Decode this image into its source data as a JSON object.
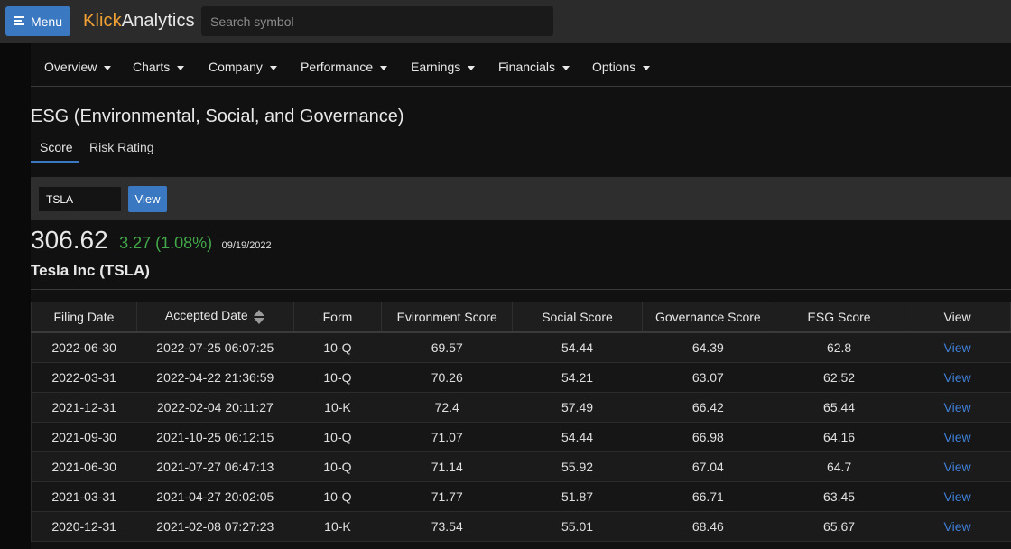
{
  "header": {
    "menu_label": "Menu",
    "logo_part1": "Klick",
    "logo_part2": "Analytics",
    "search_placeholder": "Search symbol"
  },
  "nav": [
    "Overview",
    "Charts",
    "Company",
    "Performance",
    "Earnings",
    "Financials",
    "Options"
  ],
  "page": {
    "title": "ESG (Environmental, Social, and Governance)",
    "tabs": [
      "Score",
      "Risk Rating"
    ],
    "active_tab": "Score"
  },
  "toolbar": {
    "symbol_value": "TSLA",
    "view_label": "View"
  },
  "quote": {
    "price": "306.62",
    "change": "3.27 (1.08%)",
    "date": "09/19/2022",
    "company": "Tesla Inc (TSLA)"
  },
  "colors": {
    "accent": "#3a78c2",
    "logo_orange": "#f0a133",
    "positive": "#43a84a",
    "link": "#3f7fd6"
  },
  "table": {
    "headers": [
      "Filing Date",
      "Accepted Date",
      "Form",
      "Evironment Score",
      "Social Score",
      "Governance Score",
      "ESG Score",
      "View"
    ],
    "sorted_column": "Accepted Date",
    "link_label": "View",
    "rows": [
      [
        "2022-06-30",
        "2022-07-25 06:07:25",
        "10-Q",
        "69.57",
        "54.44",
        "64.39",
        "62.8"
      ],
      [
        "2022-03-31",
        "2022-04-22 21:36:59",
        "10-Q",
        "70.26",
        "54.21",
        "63.07",
        "62.52"
      ],
      [
        "2021-12-31",
        "2022-02-04 20:11:27",
        "10-K",
        "72.4",
        "57.49",
        "66.42",
        "65.44"
      ],
      [
        "2021-09-30",
        "2021-10-25 06:12:15",
        "10-Q",
        "71.07",
        "54.44",
        "66.98",
        "64.16"
      ],
      [
        "2021-06-30",
        "2021-07-27 06:47:13",
        "10-Q",
        "71.14",
        "55.92",
        "67.04",
        "64.7"
      ],
      [
        "2021-03-31",
        "2021-04-27 20:02:05",
        "10-Q",
        "71.77",
        "51.87",
        "66.71",
        "63.45"
      ],
      [
        "2020-12-31",
        "2021-02-08 07:27:23",
        "10-K",
        "73.54",
        "55.01",
        "68.46",
        "65.67"
      ]
    ]
  }
}
